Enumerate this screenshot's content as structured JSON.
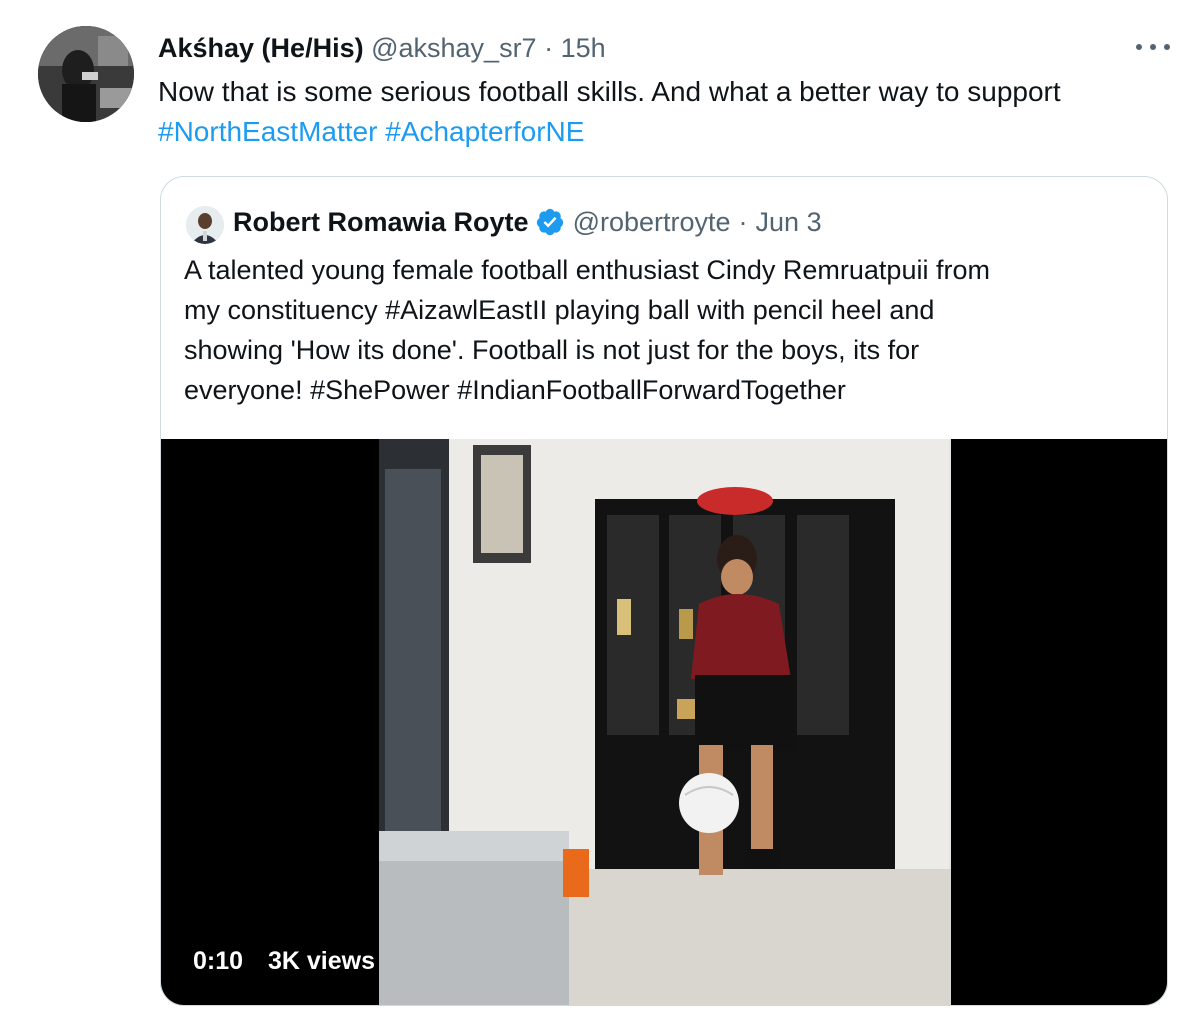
{
  "tweet": {
    "author_name": "Akśhay (He/His)",
    "author_handle": "@akshay_sr7",
    "separator": "·",
    "time": "15h",
    "text": "Now that is some serious football skills. And what a better way to support",
    "hashtags": [
      "#NorthEastMatter",
      "#AchapterforNE"
    ],
    "avatar_icon": "user-avatar-photo",
    "more_icon": "more-horizontal-icon"
  },
  "quoted_tweet": {
    "author_name": "Robert Romawia Royte",
    "author_handle": "@robertroyte",
    "separator": "·",
    "date": "Jun 3",
    "verified_icon": "verified-badge-icon",
    "text_line1": "A talented young female football enthusiast Cindy Remruatpuii from",
    "text_line2_pre": "my constituency ",
    "hashtag_1": "#AizawlEastII",
    "text_line2_post": " playing ball with pencil heel and",
    "text_line3": "showing 'How its done'. Football is not just for the boys, its for",
    "text_line4_pre": "everyone! ",
    "hashtag_2": "#ShePower",
    "hashtag_3": "#IndianFootballForwardTogether",
    "video": {
      "duration": "0:10",
      "views": "3K views"
    }
  },
  "colors": {
    "link": "#1d9bf0",
    "muted": "#536471",
    "border": "#cfd9de",
    "text": "#0f1419"
  }
}
